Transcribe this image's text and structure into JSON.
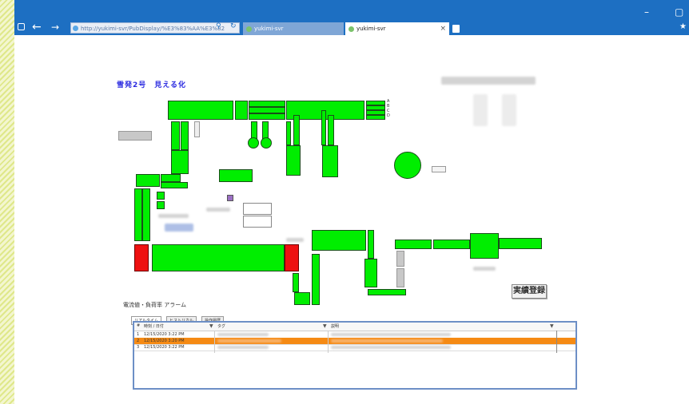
{
  "browser": {
    "url": "http://yukimi-svr/PubDisplay/%E3%83%AA%E3%82",
    "tabs": [
      {
        "label": "yukimi-svr"
      },
      {
        "label": "yukimi-svr"
      }
    ],
    "window_controls": {
      "minimize": "–",
      "restore": "▢"
    },
    "search_glyph": "⚲",
    "refresh_glyph": "↻"
  },
  "page": {
    "title": "雪発2号　見える化",
    "register_button": "実績登録",
    "abcd": [
      "A",
      "B",
      "C",
      "D"
    ]
  },
  "alarm": {
    "title": "電流値・負荷率 アラーム",
    "tabs": [
      "リアルタイム",
      "ヒストリカル",
      "操作履歴"
    ],
    "columns": [
      "#",
      "時刻 / 日付",
      "タグ",
      "説明"
    ],
    "rows": [
      {
        "num": "1",
        "time": "12/15/2020 3:22 PM",
        "selected": false
      },
      {
        "num": "2",
        "time": "12/15/2020 3:20 PM",
        "selected": true
      },
      {
        "num": "3",
        "time": "12/15/2020 3:22 PM",
        "selected": false
      }
    ]
  },
  "colors": {
    "running": "#00ee00",
    "alarm": "#ee1111",
    "selected_row": "#f58a14",
    "title_blue": "#2a2ae0"
  }
}
